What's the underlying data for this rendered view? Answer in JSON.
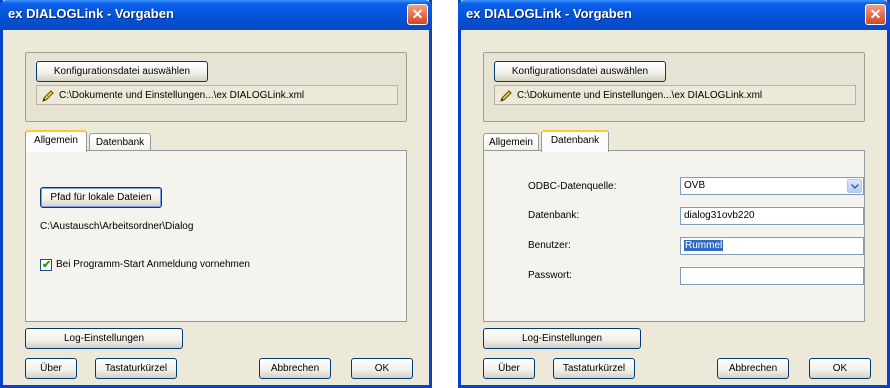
{
  "dialogs": [
    {
      "title": "ex DIALOGLink - Vorgaben",
      "close_glyph": "✕",
      "config_button": "Konfigurationsdatei auswählen",
      "config_path": "C:\\Dokumente und Einstellungen...\\ex DIALOGLink.xml",
      "tabs": [
        "Allgemein",
        "Datenbank"
      ],
      "active_tab": "Allgemein",
      "allgemein": {
        "local_path_button": "Pfad für lokale Dateien",
        "local_path": "C:\\Austausch\\Arbeitsordner\\Dialog",
        "checkbox_label": "Bei Programm-Start Anmeldung vornehmen",
        "checkbox_checked": true
      },
      "buttons": {
        "log": "Log-Einstellungen",
        "about": "Über",
        "shortcuts": "Tastaturkürzel",
        "cancel": "Abbrechen",
        "ok": "OK"
      }
    },
    {
      "title": "ex DIALOGLink - Vorgaben",
      "close_glyph": "✕",
      "config_button": "Konfigurationsdatei auswählen",
      "config_path": "C:\\Dokumente und Einstellungen...\\ex DIALOGLink.xml",
      "tabs": [
        "Allgemein",
        "Datenbank"
      ],
      "active_tab": "Datenbank",
      "datenbank": {
        "odbc_label": "ODBC-Datenquelle:",
        "odbc_value": "OVB",
        "db_label": "Datenbank:",
        "db_value": "dialog31ovb220",
        "user_label": "Benutzer:",
        "user_value": "Rummel",
        "password_label": "Passwort:",
        "password_value": ""
      },
      "buttons": {
        "log": "Log-Einstellungen",
        "about": "Über",
        "shortcuts": "Tastaturkürzel",
        "cancel": "Abbrechen",
        "ok": "OK"
      }
    }
  ],
  "colors": {
    "titlebar": "#0553d9",
    "dialog_face": "#ece9d8",
    "active_tab_accent": "#ffc83c",
    "selection": "#316ac5"
  },
  "icons": [
    "pencil-icon",
    "close-icon",
    "checkmark-icon",
    "chevron-down-icon"
  ]
}
